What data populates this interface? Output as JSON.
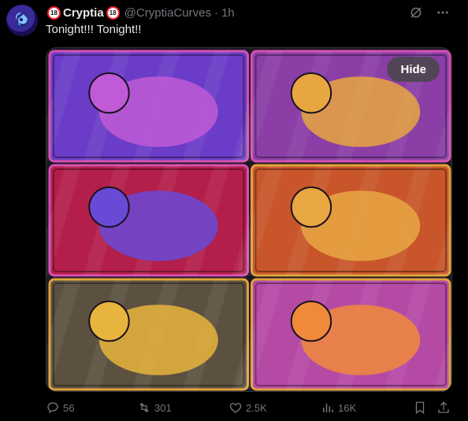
{
  "post": {
    "badge_left": "18",
    "display_name": "Cryptia",
    "badge_right": "18",
    "handle": "@CryptiaCurves",
    "separator": "·",
    "time": "1h",
    "text": "Tonight!!! Tonight!!"
  },
  "media": {
    "hide_label": "Hide",
    "panels": [
      {
        "bg": "#6a3cc7",
        "accent": "#c05ad6",
        "frame": "#d64fb1"
      },
      {
        "bg": "#8a3ea6",
        "accent": "#e7a640",
        "frame": "#d64fb1"
      },
      {
        "bg": "#b31e4a",
        "accent": "#6a49d6",
        "frame": "#d64fb1"
      },
      {
        "bg": "#c8562a",
        "accent": "#e9a742",
        "frame": "#e0a23a"
      },
      {
        "bg": "#5c5140",
        "accent": "#e7b53d",
        "frame": "#e0a23a"
      },
      {
        "bg": "#b54aa5",
        "accent": "#f08a3a",
        "frame": "#e0a23a"
      }
    ]
  },
  "actions": {
    "replies": "56",
    "reposts": "301",
    "likes": "2.5K",
    "views": "16K"
  },
  "icons": {
    "grok": "grok-icon",
    "more": "more-icon",
    "reply": "reply-icon",
    "repost": "repost-icon",
    "like": "heart-icon",
    "views": "views-icon",
    "bookmark": "bookmark-icon",
    "share": "share-icon"
  },
  "colors": {
    "background": "#000000",
    "text": "#e7e9ea",
    "muted": "#71767b"
  }
}
